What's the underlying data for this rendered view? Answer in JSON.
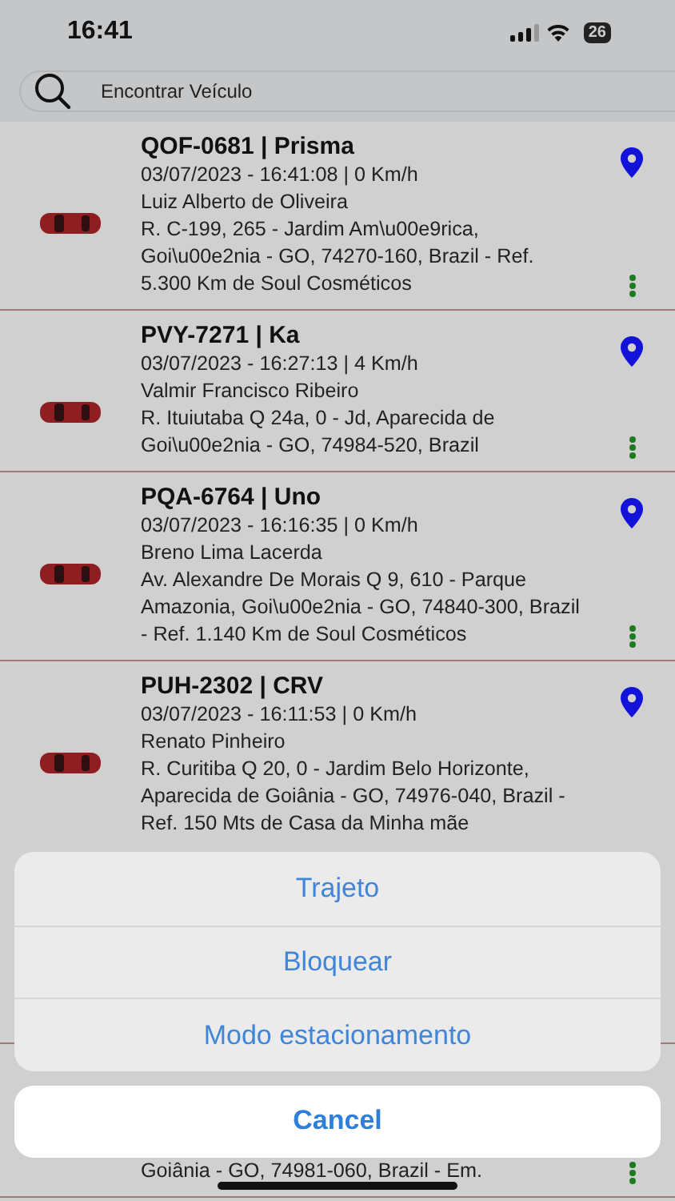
{
  "status_bar": {
    "time": "16:41",
    "battery": "26"
  },
  "search": {
    "placeholder": "Encontrar Veículo"
  },
  "vehicles": [
    {
      "title": "QOF-0681 | Prisma",
      "datetime_speed": "03/07/2023 - 16:41:08 | 0 Km/h",
      "driver": "Luiz Alberto de Oliveira",
      "address": "R. C-199, 265 - Jardim Am\\u00e9rica, Goi\\u00e2nia - GO, 74270-160, Brazil - Ref. 5.300 Km de Soul Cosméticos"
    },
    {
      "title": "PVY-7271 | Ka",
      "datetime_speed": "03/07/2023 - 16:27:13 | 4 Km/h",
      "driver": "Valmir Francisco Ribeiro",
      "address": "R. Ituiutaba Q 24a, 0 - Jd, Aparecida de Goi\\u00e2nia - GO, 74984-520, Brazil"
    },
    {
      "title": "PQA-6764 | Uno",
      "datetime_speed": "03/07/2023 - 16:16:35 | 0 Km/h",
      "driver": "Breno Lima Lacerda",
      "address": "Av. Alexandre De Morais Q 9, 610 - Parque Amazonia, Goi\\u00e2nia - GO, 74840-300, Brazil - Ref. 1.140 Km de Soul Cosméticos"
    },
    {
      "title": "PUH-2302 | CRV",
      "datetime_speed": "03/07/2023 - 16:11:53 | 0 Km/h",
      "driver": "Renato Pinheiro",
      "address": "R. Curitiba Q 20, 0 - Jardim Belo Horizonte, Aparecida de Goiânia - GO, 74976-040, Brazil - Ref. 150 Mts de Casa da Minha mãe"
    },
    {
      "address": "Goiânia - GO, 74981-060, Brazil - Em."
    }
  ],
  "action_sheet": {
    "actions": [
      "Trajeto",
      "Bloquear",
      "Modo estacionamento"
    ],
    "cancel": "Cancel"
  }
}
